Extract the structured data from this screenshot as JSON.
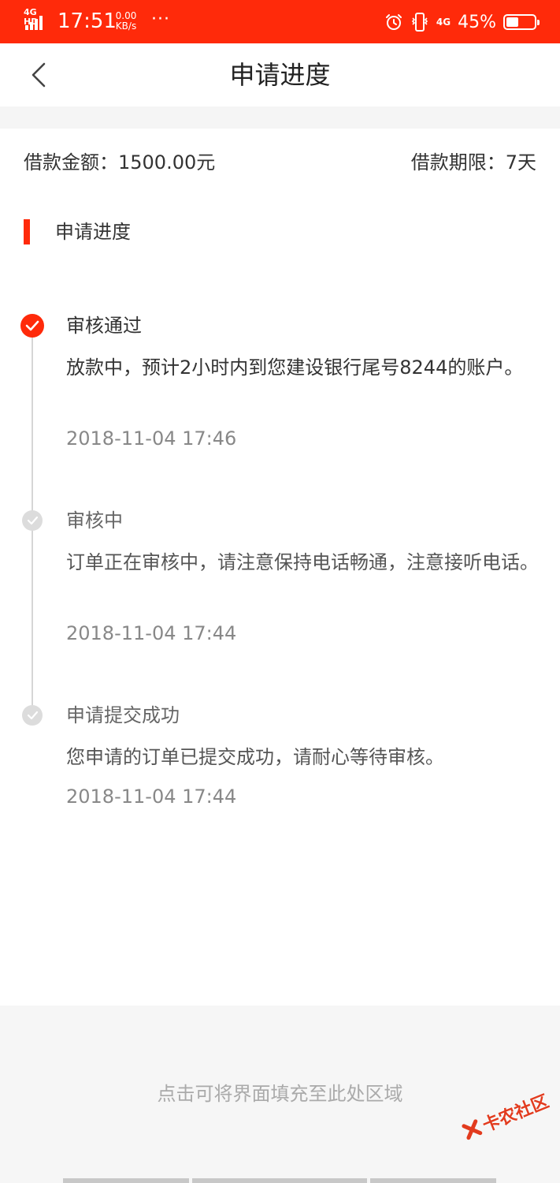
{
  "status_bar": {
    "network_tag": "4G HD",
    "time": "17:51",
    "speed_value": "0.00",
    "speed_unit": "KB/s",
    "more": "···",
    "signal_4g": "4G",
    "battery_percent": "45%",
    "battery_level": 0.45,
    "icons": [
      "alarm-icon",
      "vibrate-icon",
      "battery-icon"
    ]
  },
  "navbar": {
    "back_icon": "chevron-left-icon",
    "title": "申请进度"
  },
  "loan": {
    "amount": "借款金额：1500.00元",
    "term": "借款期限：7天"
  },
  "section": {
    "title": "申请进度"
  },
  "timeline": [
    {
      "title": "审核通过",
      "description": "放款中，预计2小时内到您建设银行尾号8244的账户。",
      "time": "2018-11-04 17:46",
      "state": "active"
    },
    {
      "title": "审核中",
      "description": "订单正在审核中，请注意保持电话畅通，注意接听电话。",
      "time": "2018-11-04 17:44",
      "state": "done"
    },
    {
      "title": "申请提交成功",
      "description": "您申请的订单已提交成功，请耐心等待审核。",
      "time": "2018-11-04 17:44",
      "state": "done"
    }
  ],
  "bottom": {
    "fill_hint": "点击可将界面填充至此处区域",
    "watermark_text": "卡农社区"
  },
  "colors": {
    "accent": "#ff2a0a",
    "muted_dot": "#dcdcdc",
    "hint_text": "#aaaaaa"
  }
}
